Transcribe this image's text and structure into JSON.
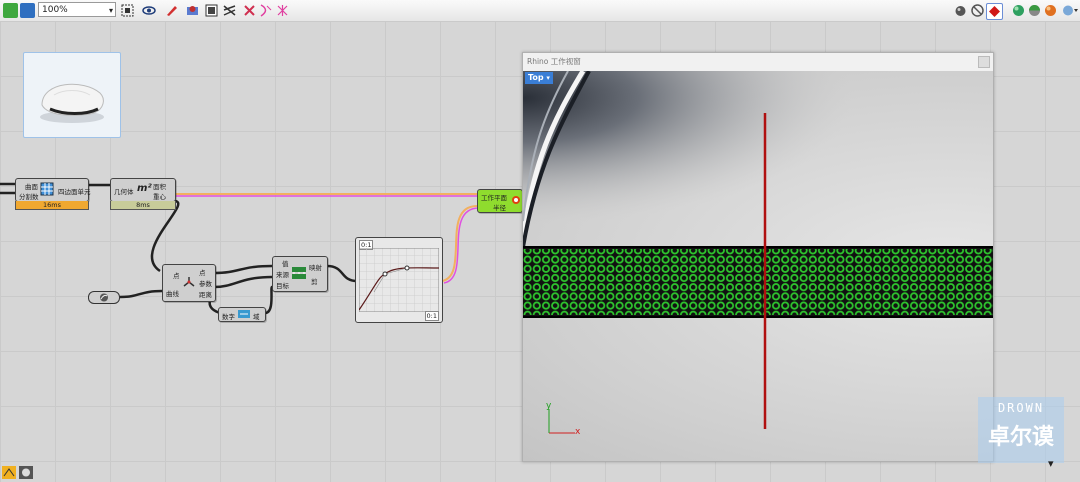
{
  "toolbar": {
    "zoom_value": "100%",
    "left_icons": [
      "save-icon",
      "save-disk-icon"
    ],
    "center_icons": [
      "fit-icon",
      "preview-eye-icon",
      "paint-icon",
      "preview-wire-icon",
      "preview-shade-icon",
      "preview-selected-icon",
      "disable-icon",
      "remove-icon",
      "remove-all-icon"
    ],
    "right_icons": [
      "render-icon",
      "no-preview-icon",
      "lock-icon",
      "sphere-green-icon",
      "sphere-multi-icon",
      "sphere-orange-icon",
      "bake-icon"
    ]
  },
  "components": {
    "brep": {
      "in1": "曲面",
      "in2": "分割数",
      "title": "四边面单元",
      "timer": "16ms"
    },
    "area": {
      "in": "几何体",
      "icon": "m²",
      "out1": "面积",
      "out2": "重心",
      "timer": "8ms"
    },
    "curve_closest": {
      "in1": "点",
      "in2": "曲线",
      "out1": "点",
      "out2": "参数",
      "out3": "距离"
    },
    "remap": {
      "in1": "值",
      "in2": "来源",
      "in3": "目标",
      "out1": "映射",
      "out2": "剪"
    },
    "bounds": {
      "in": "数字",
      "out": "域"
    },
    "graph": {
      "label_top": "0:1",
      "label_bottom": "0:1"
    },
    "plane": {
      "in1": "工作平面",
      "in2": "半径"
    }
  },
  "rhino": {
    "title": "Rhino 工作视窗",
    "viewport_label": "Top",
    "axis_x": "x",
    "axis_y": "y"
  },
  "watermark": {
    "en": "DROWN",
    "cn": "卓尔谟"
  },
  "colors": {
    "timer_orange": "#f0a830",
    "timer_olive": "#c8cc9a",
    "comp_green": "#8fdc2e",
    "wire_pink": "#e050e0",
    "wire_orange": "#f2b060",
    "ring_green": "#2ec42e",
    "axis_red": "#b01010"
  }
}
